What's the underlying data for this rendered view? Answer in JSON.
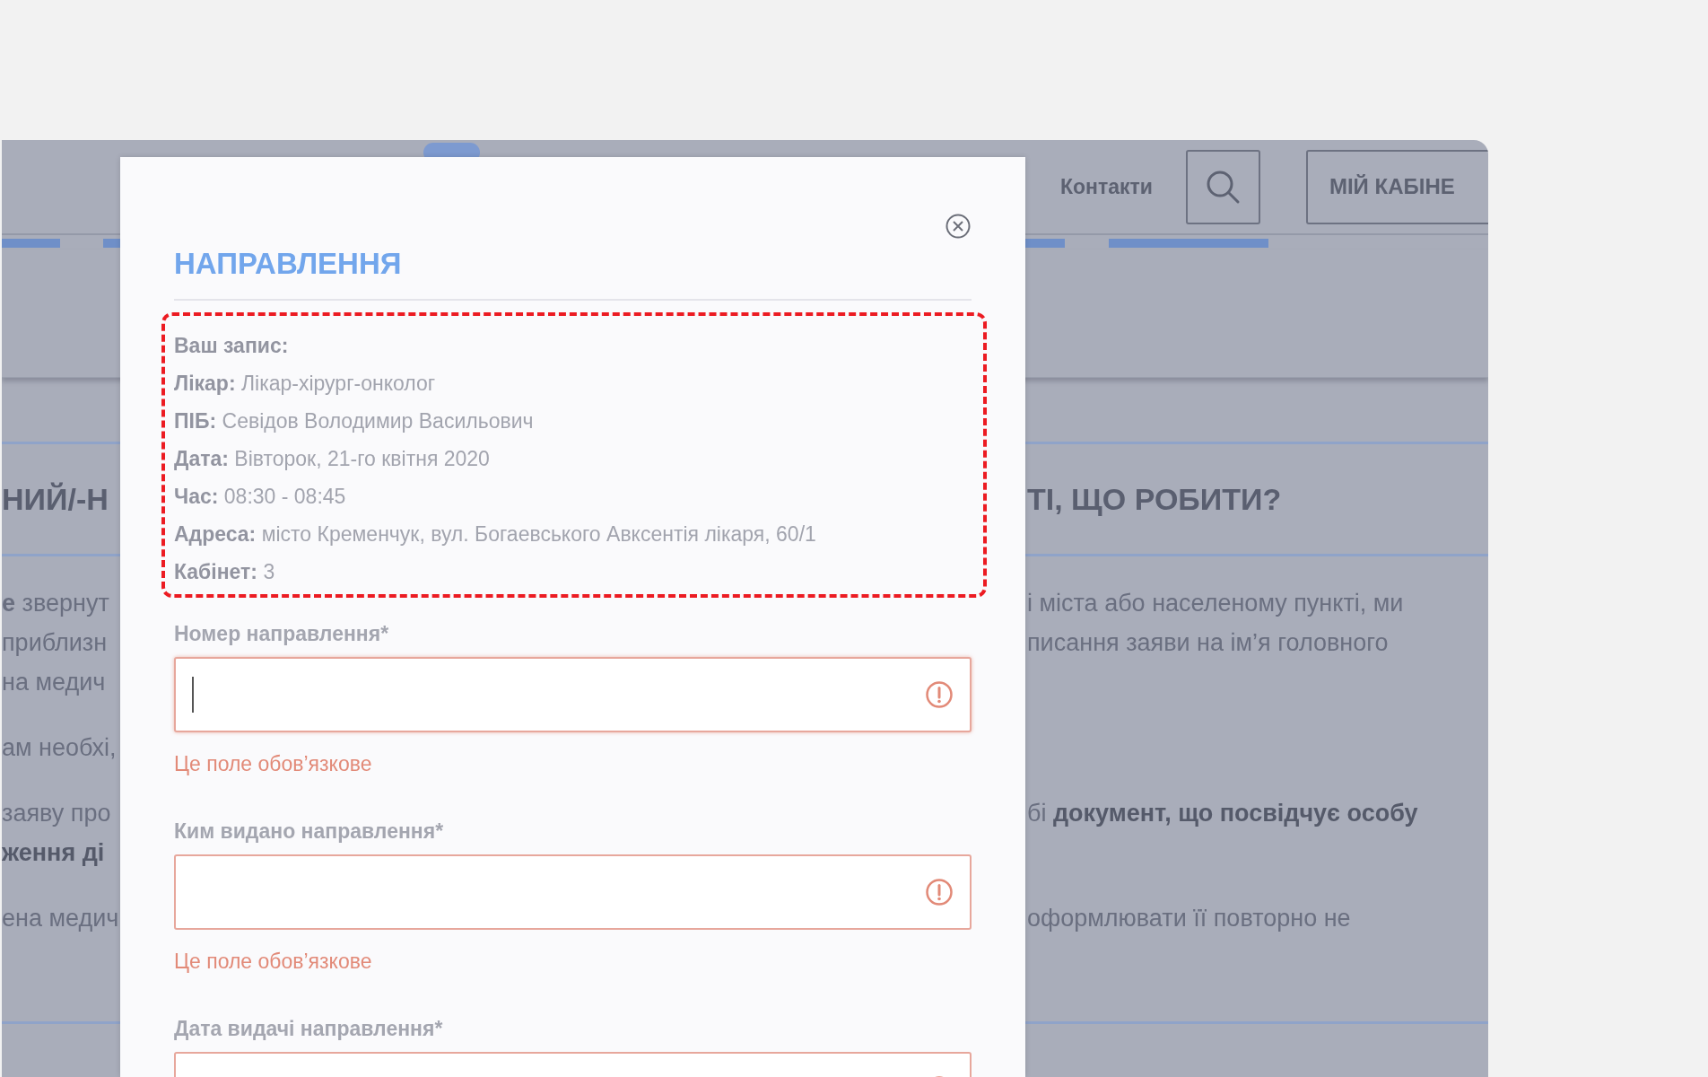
{
  "background": {
    "nav_link": "Контакти",
    "cabinet_button": "МІЙ КАБІНЕ",
    "heading_left": "НИЙ/-Н",
    "heading_right": "ТІ, ЩО РОБИТИ?",
    "paragraphs": [
      {
        "lines": [
          {
            "left": "**е** звернут",
            "right": "і міста або населеному пункті, ми",
            "left_bold": false
          },
          {
            "left": "приблизн",
            "right": "писання заяви на ім’я головного",
            "left_bold": false
          },
          {
            "left": "на медич",
            "left_bold": false
          }
        ]
      },
      {
        "lines": [
          {
            "left": "ам необхі,",
            "left_bold": false
          }
        ]
      },
      {
        "lines": [
          {
            "left": "заяву про",
            "right": "бі **документ, що посвідчує особу**",
            "left_bold": false
          },
          {
            "left": "ження ді",
            "left_bold": true
          }
        ]
      },
      {
        "lines": [
          {
            "left": "ена медич",
            "right": "оформлювати її повторно не",
            "left_bold": false
          }
        ]
      }
    ]
  },
  "modal": {
    "title": "НАПРАВЛЕННЯ",
    "appointment": {
      "heading": "Ваш запис:",
      "rows": [
        {
          "label": "Лікар:",
          "value": "Лікар-хірург-онколог"
        },
        {
          "label": "ПІБ:",
          "value": "Севідов Володимир Васильович"
        },
        {
          "label": "Дата:",
          "value": "Вівторок, 21-го квітня 2020"
        },
        {
          "label": "Час:",
          "value": "08:30 - 08:45"
        },
        {
          "label": "Адреса:",
          "value": "місто Кременчук, вул. Богаевського Авксентія лікаря, 60/1"
        },
        {
          "label": "Кабінет:",
          "value": "3"
        }
      ]
    },
    "fields": [
      {
        "label": "Номер направлення*",
        "invalid": true,
        "focused": true,
        "error": "Це поле обов’язкове"
      },
      {
        "label": "Ким видано направлення*",
        "invalid": true,
        "focused": false,
        "error": "Це поле обов’язкове"
      },
      {
        "label": "Дата видачі направлення*",
        "invalid": true,
        "focused": false
      }
    ]
  }
}
